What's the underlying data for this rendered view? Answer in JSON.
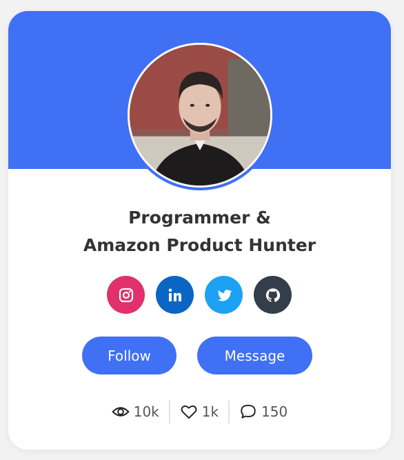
{
  "card": {
    "title_line1": "Programmer &",
    "title_line2": "Amazon Product Hunter"
  },
  "socials": [
    {
      "name": "instagram",
      "icon": "instagram-icon",
      "color": "#e1306c"
    },
    {
      "name": "linkedin",
      "icon": "linkedin-icon",
      "color": "#0a66c2"
    },
    {
      "name": "twitter",
      "icon": "twitter-icon",
      "color": "#1da1f2"
    },
    {
      "name": "github",
      "icon": "github-icon",
      "color": "#333e4a"
    }
  ],
  "buttons": {
    "follow": "Follow",
    "message": "Message"
  },
  "stats": {
    "views": "10k",
    "likes": "1k",
    "comments": "150"
  },
  "colors": {
    "accent": "#4070f4",
    "background": "#f2f2f2",
    "card": "#ffffff"
  }
}
